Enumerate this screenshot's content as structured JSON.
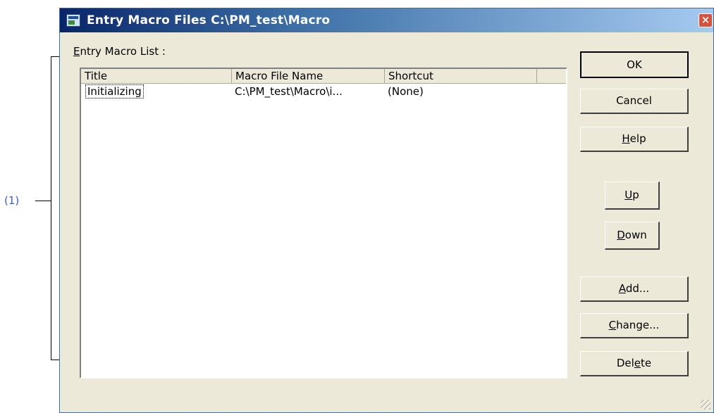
{
  "annotation": {
    "label": "(1)"
  },
  "window": {
    "title": "Entry Macro Files  C:\\PM_test\\Macro",
    "close_glyph": "×"
  },
  "group": {
    "mnemonic": "E",
    "label_rest": "ntry Macro List :"
  },
  "list": {
    "columns": [
      "Title",
      "Macro File Name",
      "Shortcut"
    ],
    "rows": [
      {
        "title": "Initializing",
        "file": "C:\\PM_test\\Macro\\i...",
        "shortcut": "(None)"
      }
    ]
  },
  "buttons": {
    "ok": "OK",
    "cancel": "Cancel",
    "help": {
      "mn": "H",
      "rest": "elp"
    },
    "up": {
      "mn": "U",
      "rest": "p"
    },
    "down": {
      "mn": "D",
      "rest": "own"
    },
    "add": {
      "mn": "A",
      "rest": "dd..."
    },
    "change": {
      "mn": "C",
      "rest": "hange..."
    },
    "delete": {
      "pre": "Del",
      "mn": "e",
      "rest": "te"
    }
  }
}
